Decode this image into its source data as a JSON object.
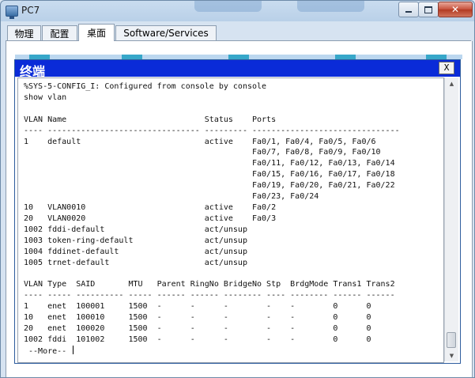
{
  "window": {
    "title": "PC7",
    "icons": {
      "app": "computer-icon",
      "minimize": "minimize-icon",
      "maximize": "maximize-icon",
      "close": "close-icon"
    },
    "close_glyph": "✕"
  },
  "tabs": [
    {
      "label": "物理"
    },
    {
      "label": "配置"
    },
    {
      "label": "桌面",
      "active": true
    },
    {
      "label": "Software/Services"
    }
  ],
  "terminal": {
    "title": "终端",
    "close_label": "X",
    "lines": [
      "%SYS-5-CONFIG_I: Configured from console by console",
      "show vlan",
      "",
      "VLAN Name                             Status    Ports",
      "---- -------------------------------- --------- -------------------------------",
      "1    default                          active    Fa0/1, Fa0/4, Fa0/5, Fa0/6",
      "                                                Fa0/7, Fa0/8, Fa0/9, Fa0/10",
      "                                                Fa0/11, Fa0/12, Fa0/13, Fa0/14",
      "                                                Fa0/15, Fa0/16, Fa0/17, Fa0/18",
      "                                                Fa0/19, Fa0/20, Fa0/21, Fa0/22",
      "                                                Fa0/23, Fa0/24",
      "10   VLAN0010                         active    Fa0/2",
      "20   VLAN0020                         active    Fa0/3",
      "1002 fddi-default                     act/unsup",
      "1003 token-ring-default               act/unsup",
      "1004 fddinet-default                  act/unsup",
      "1005 trnet-default                    act/unsup",
      "",
      "VLAN Type  SAID       MTU   Parent RingNo BridgeNo Stp  BrdgMode Trans1 Trans2",
      "---- ----- ---------- ----- ------ ------ -------- ---- -------- ------ ------",
      "1    enet  100001     1500  -      -      -        -    -        0      0",
      "10   enet  100010     1500  -      -      -        -    -        0      0",
      "20   enet  100020     1500  -      -      -        -    -        0      0",
      "1002 fddi  101002     1500  -      -      -        -    -        0      0"
    ],
    "more_prompt": " --More-- "
  },
  "colors": {
    "terminal_header": "#0a2bd8",
    "window_frame": "#b9d0e8",
    "accent": "#37a7c9"
  }
}
